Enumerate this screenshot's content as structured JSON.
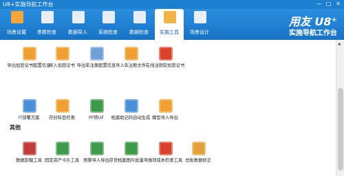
{
  "window": {
    "title": "U8+实施导航工作台",
    "min": "—",
    "max": "□",
    "close": "✕"
  },
  "toolbar": {
    "tabs": [
      {
        "label": "场景设置",
        "icon": "scene-settings-icon",
        "color": "#f4a63a"
      },
      {
        "label": "参数检查",
        "icon": "parameter-check-icon",
        "color": "#e8eef6"
      },
      {
        "label": "数据导入",
        "icon": "data-import-icon",
        "color": "#e8eef6"
      },
      {
        "label": "系统检查",
        "icon": "system-check-icon",
        "color": "#e8eef6"
      },
      {
        "label": "数据检查",
        "icon": "data-check-icon",
        "color": "#e8eef6"
      },
      {
        "label": "实施工具",
        "icon": "implementation-tools-icon",
        "color": "#f0b34a"
      },
      {
        "label": "场景设计",
        "icon": "scene-design-icon",
        "color": "#e8eef6"
      }
    ],
    "active": "实施工具"
  },
  "brand": {
    "logo": "用友 U8⁺",
    "slogan": "实施导航工作台"
  },
  "group1": [
    {
      "label": "导出加密证书配置信息",
      "icon": "export-cert-config-icon",
      "color": "#f0a030"
    },
    {
      "label": "导入加密证书",
      "icon": "import-cert-icon",
      "color": "#f0a030"
    },
    {
      "label": "导出年注册配置信息",
      "icon": "export-year-reg-icon",
      "color": "#6fa0d8"
    },
    {
      "label": "导入年注册文件",
      "icon": "import-year-reg-icon",
      "color": "#f0a030"
    },
    {
      "label": "在线注销软加密证书",
      "icon": "online-revoke-cert-icon",
      "color": "#d9412b"
    }
  ],
  "section_title": "其他",
  "group2": [
    {
      "label": "IT部署方案",
      "icon": "it-deployment-icon",
      "color": "#4a90d9"
    },
    {
      "label": "存封科目检查",
      "icon": "account-check-icon",
      "color": "#f0a030"
    },
    {
      "label": "PF转UF",
      "icon": "pf-to-uf-icon",
      "color": "#3c9a4a"
    },
    {
      "label": "档案助记码自动生成",
      "icon": "mnemonic-code-icon",
      "color": "#4a90d9"
    },
    {
      "label": "模型导入导出",
      "icon": "model-import-export-icon",
      "color": "#f0a030"
    }
  ],
  "group3": [
    {
      "label": "数据卸载工具",
      "icon": "data-unload-icon",
      "color": "#c23a3a"
    },
    {
      "label": "固定资产卡片工具",
      "icon": "fixed-asset-card-icon",
      "color": "#3c9a4a"
    },
    {
      "label": "预算导入导出",
      "icon": "budget-import-export-icon",
      "color": "#3c9a4a"
    },
    {
      "label": "存货档案图片批量导入",
      "icon": "inventory-image-import-icon",
      "color": "#3c9a4a"
    },
    {
      "label": "分项成本检查工具",
      "icon": "cost-check-icon",
      "color": "#d9412b"
    },
    {
      "label": "总账数据修正",
      "icon": "ledger-fix-icon",
      "color": "#e2a13a"
    }
  ]
}
